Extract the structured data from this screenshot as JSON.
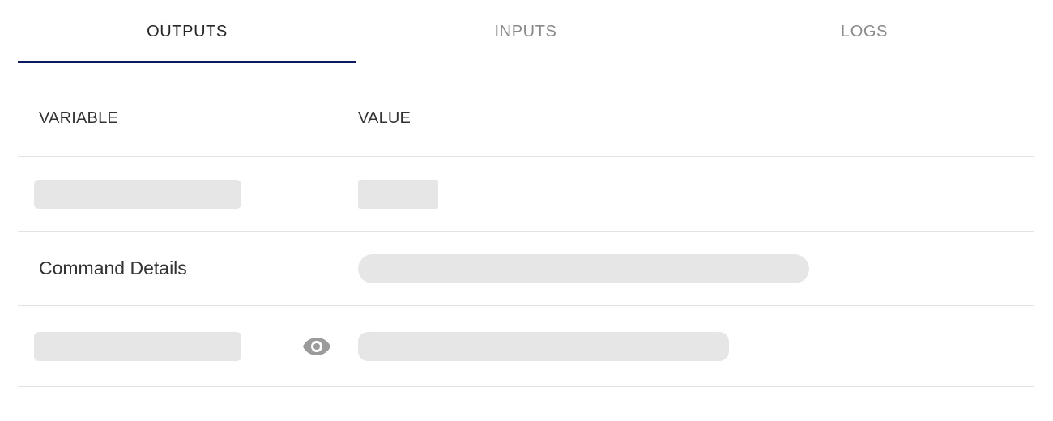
{
  "tabs": [
    {
      "label": "OUTPUTS",
      "active": true
    },
    {
      "label": "INPUTS",
      "active": false
    },
    {
      "label": "LOGS",
      "active": false
    }
  ],
  "table": {
    "headers": {
      "variable": "VARIABLE",
      "value": "VALUE"
    },
    "rows": [
      {
        "variable": "",
        "value": "",
        "variable_loading": true,
        "value_loading": true
      },
      {
        "variable": "Command Details",
        "value": "",
        "variable_loading": false,
        "value_loading": true
      },
      {
        "variable": "",
        "value": "",
        "variable_loading": true,
        "value_loading": true,
        "icon": "eye-icon"
      }
    ]
  },
  "colors": {
    "active_tab_indicator": "#0d1b5e",
    "inactive_tab_text": "#8a8a8a",
    "skeleton": "#e6e6e6",
    "divider": "#e2e2e2",
    "icon": "#9b9b9b"
  }
}
